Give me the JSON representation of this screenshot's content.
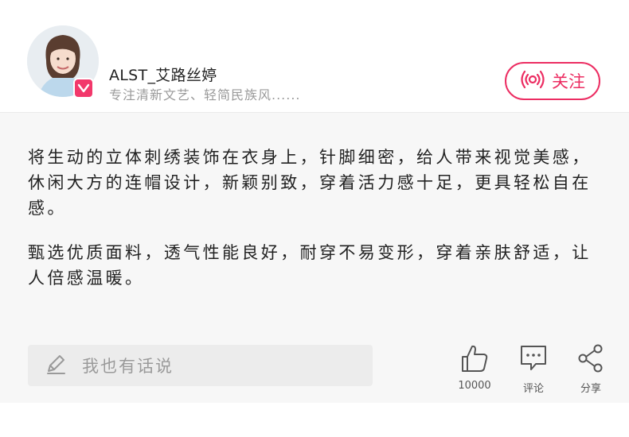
{
  "author": {
    "name": "ALST_艾路丝婷",
    "description": "专注清新文艺、轻简民族风......",
    "verified_badge_icon": "v-badge-icon"
  },
  "follow": {
    "label": "关注",
    "icon": "broadcast-icon"
  },
  "article": {
    "paragraphs": [
      "将生动的立体刺绣装饰在衣身上，针脚细密，给人带来视觉美感，休闲大方的连帽设计，新颖别致，穿着活力感十足，更具轻松自在感。",
      "甄选优质面料，透气性能良好，耐穿不易变形，穿着亲肤舒适，让人倍感温暖。"
    ]
  },
  "comment_input": {
    "placeholder": "我也有话说",
    "icon": "pencil-icon"
  },
  "actions": {
    "like": {
      "icon": "thumbs-up-icon",
      "label": "10000"
    },
    "comment": {
      "icon": "comment-bubble-icon",
      "label": "评论"
    },
    "share": {
      "icon": "share-icon",
      "label": "分享"
    }
  },
  "colors": {
    "accent": "#ec2d62",
    "badge": "#f2386b",
    "content_bg": "#f7f7f7",
    "input_bg": "#ececec",
    "muted_text": "#9a9a9a"
  }
}
